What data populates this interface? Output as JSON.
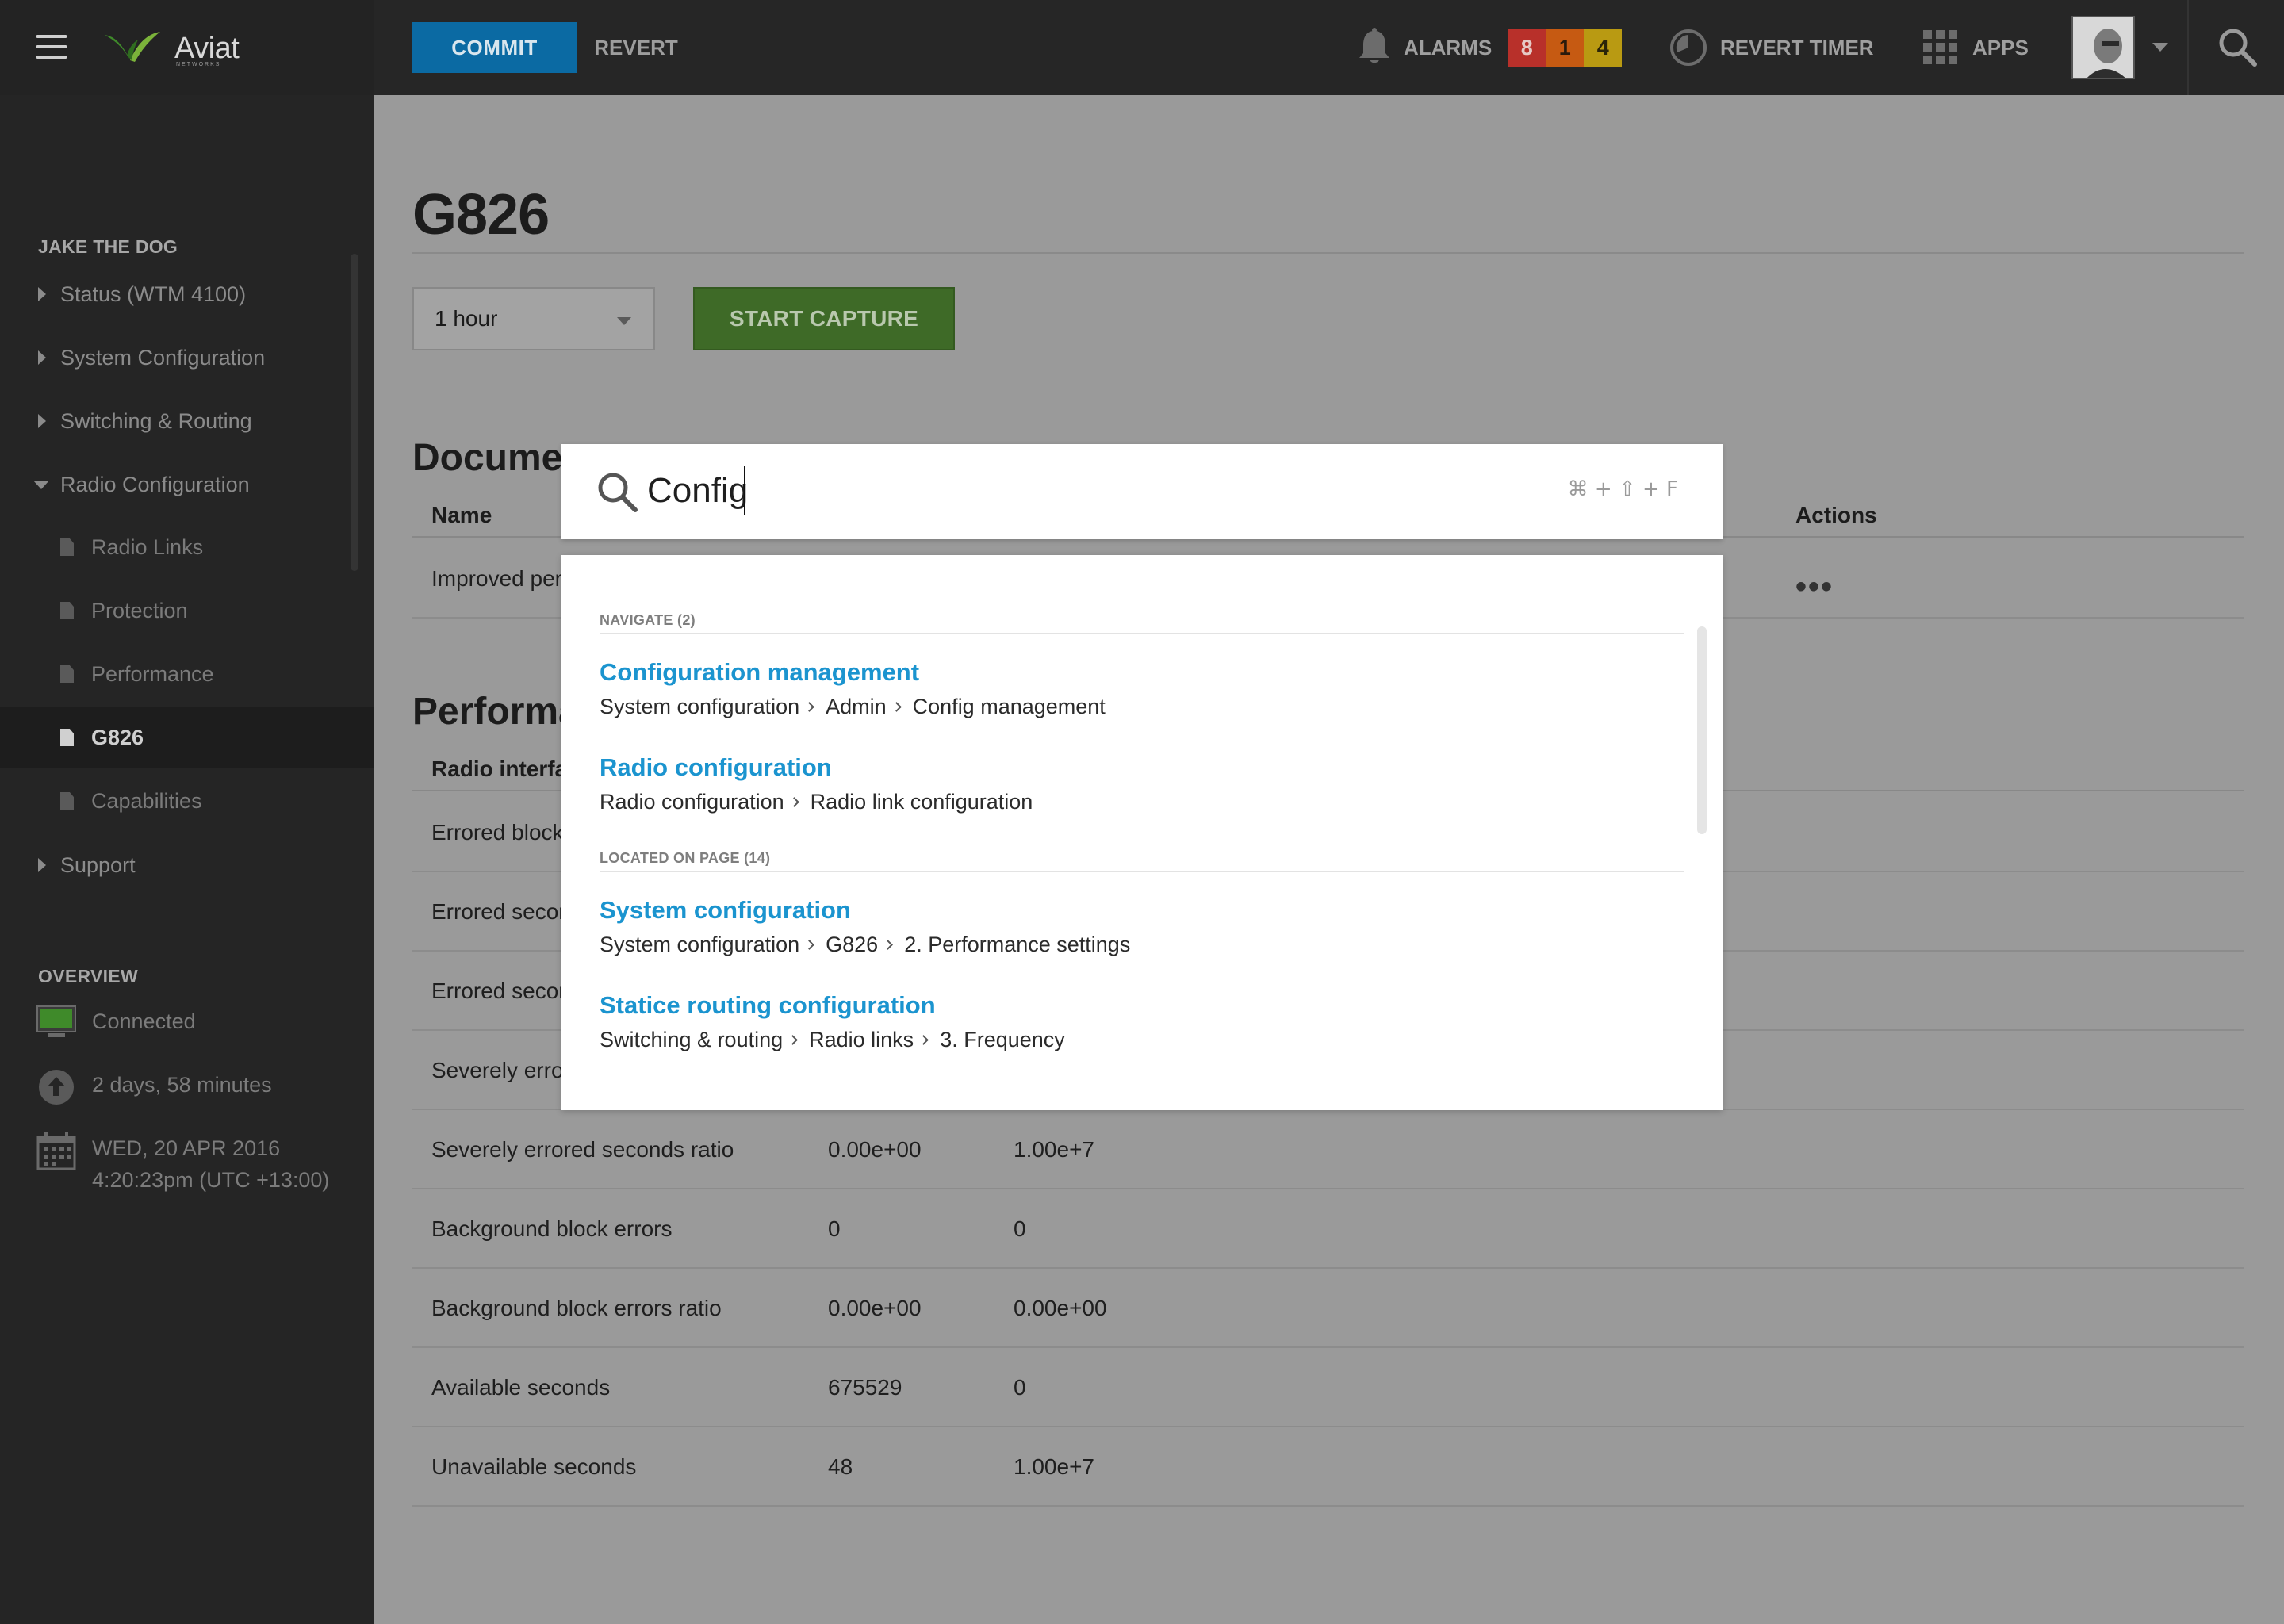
{
  "header": {
    "brand": "Aviat",
    "brand_sub": "NETWORKS",
    "commit_label": "COMMIT",
    "revert_label": "REVERT",
    "alarms_label": "ALARMS",
    "alarm_counts": [
      "8",
      "1",
      "4"
    ],
    "alarm_colors": [
      "#b8302a",
      "#c65a12",
      "#b99a12"
    ],
    "revert_timer_label": "REVERT TIMER",
    "apps_label": "APPS"
  },
  "sidebar": {
    "device_heading": "JAKE THE DOG",
    "items": [
      {
        "label": "Status (WTM 4100)"
      },
      {
        "label": "System Configuration"
      },
      {
        "label": "Switching & Routing"
      },
      {
        "label": "Radio Configuration"
      },
      {
        "label": "Support"
      }
    ],
    "sub_items": [
      {
        "label": "Radio Links"
      },
      {
        "label": "Protection"
      },
      {
        "label": "Performance"
      },
      {
        "label": "G826"
      },
      {
        "label": "Capabilities"
      }
    ],
    "overview_heading": "OVERVIEW",
    "overview": {
      "status": "Connected",
      "uptime": "2 days, 58 minutes",
      "date": "WED, 20 APR 2016",
      "time": "4:20:23pm (UTC +13:00)"
    }
  },
  "main": {
    "title": "G826",
    "duration_select": "1 hour",
    "start_capture_label": "START CAPTURE",
    "documents_heading": "Docume",
    "documents_columns": {
      "name": "Name",
      "actions": "Actions"
    },
    "documents_row": {
      "name": "Improved per",
      "actions": "•••"
    },
    "performance_heading": "Performa",
    "performance_column": "Radio interfa",
    "performance_rows_hidden": [
      {
        "label": "Errored block"
      },
      {
        "label": "Errored secon"
      },
      {
        "label": "Errored secon"
      },
      {
        "label": "Severely erro"
      }
    ],
    "performance_rows": [
      {
        "label": "Severely errored seconds ratio",
        "v1": "0.00e+00",
        "v2": "1.00e+7"
      },
      {
        "label": "Background block errors",
        "v1": "0",
        "v2": "0"
      },
      {
        "label": "Background block errors ratio",
        "v1": "0.00e+00",
        "v2": "0.00e+00"
      },
      {
        "label": "Available seconds",
        "v1": "675529",
        "v2": "0"
      },
      {
        "label": "Unavailable seconds",
        "v1": "48",
        "v2": "1.00e+7"
      }
    ]
  },
  "search": {
    "query": "Config",
    "shortcut": "⌘ + ⇧ + F",
    "groups": [
      {
        "label": "NAVIGATE (2)",
        "results": [
          {
            "title": "Configuration management",
            "path": [
              "System configuration",
              "Admin",
              "Config management"
            ]
          },
          {
            "title": "Radio configuration",
            "path": [
              "Radio configuration",
              "Radio link configuration"
            ]
          }
        ]
      },
      {
        "label": "LOCATED ON PAGE (14)",
        "results": [
          {
            "title": "System configuration",
            "path": [
              "System configuration",
              "G826",
              "2. Performance settings"
            ]
          },
          {
            "title": "Statice routing configuration",
            "path": [
              "Switching & routing",
              "Radio links",
              "3. Frequency"
            ]
          }
        ]
      }
    ]
  }
}
